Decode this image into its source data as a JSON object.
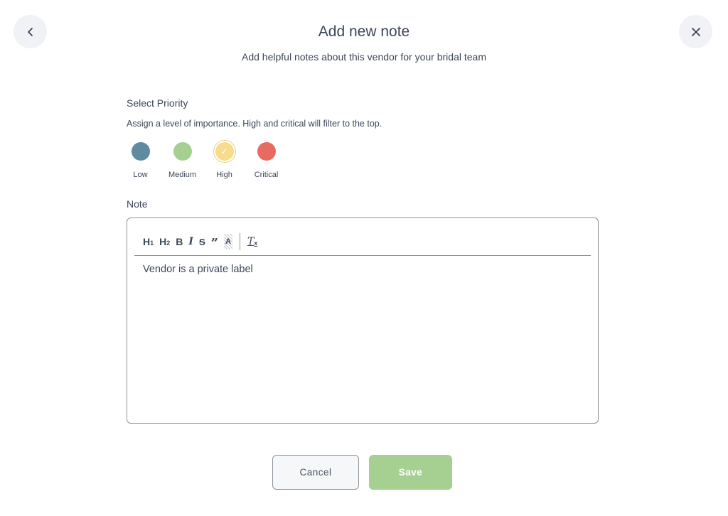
{
  "header": {
    "title": "Add new note",
    "subtitle": "Add helpful notes about this vendor for your bridal team",
    "back_icon": "chevron-left-icon",
    "close_icon": "close-icon"
  },
  "priority": {
    "heading": "Select Priority",
    "help": "Assign a level of importance. High and critical will filter to the top.",
    "selected": "High",
    "options": [
      {
        "label": "Low",
        "color": "#5f8ba1"
      },
      {
        "label": "Medium",
        "color": "#a5d092"
      },
      {
        "label": "High",
        "color": "#f6dc8c"
      },
      {
        "label": "Critical",
        "color": "#e76b60"
      }
    ]
  },
  "note": {
    "heading": "Note",
    "toolbar": {
      "h1": "H",
      "h1_sub": "1",
      "h2": "H",
      "h2_sub": "2",
      "bold": "B",
      "italic": "I",
      "strike": "S",
      "quote": "”",
      "highlight": "A",
      "clear": "T",
      "clear_sub": "x"
    },
    "content": "Vendor is a private label"
  },
  "actions": {
    "cancel_label": "Cancel",
    "save_label": "Save"
  }
}
